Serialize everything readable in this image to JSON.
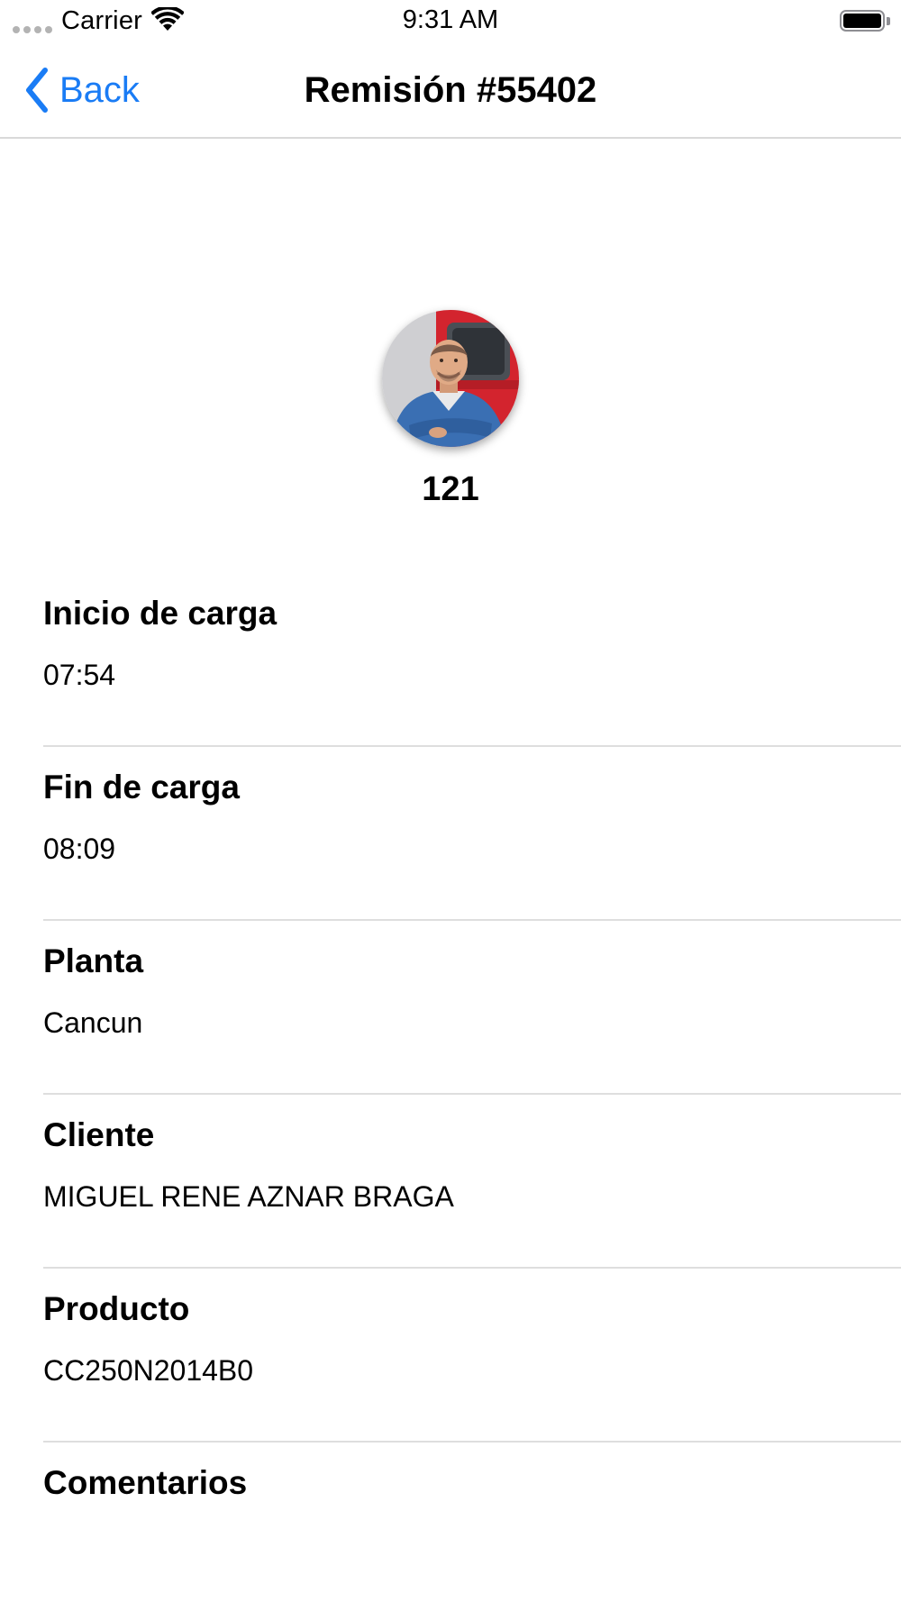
{
  "status_bar": {
    "carrier": "Carrier",
    "time": "9:31 AM",
    "icons": [
      "signal-dots-icon",
      "wifi-icon",
      "battery-icon"
    ]
  },
  "nav": {
    "back_label": "Back",
    "title": "Remisión #55402",
    "accent_color": "#1a7cf5"
  },
  "profile": {
    "unit_number": "121",
    "avatar": "driver-photo"
  },
  "details": [
    {
      "label": "Inicio de carga",
      "value": "07:54"
    },
    {
      "label": "Fin de carga",
      "value": "08:09"
    },
    {
      "label": "Planta",
      "value": "Cancun"
    },
    {
      "label": "Cliente",
      "value": "MIGUEL RENE AZNAR BRAGA"
    },
    {
      "label": "Producto",
      "value": "CC250N2014B0"
    },
    {
      "label": "Comentarios",
      "value": ""
    }
  ]
}
